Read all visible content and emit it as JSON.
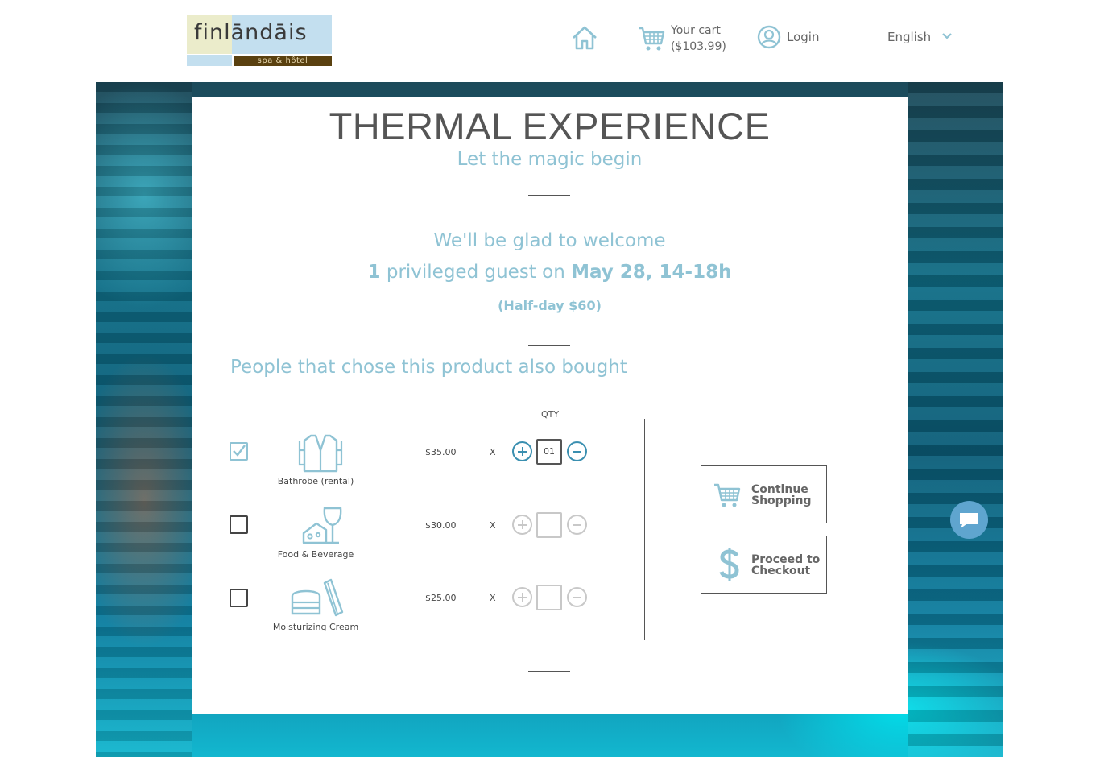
{
  "header": {
    "logo": {
      "word": "finlāndāis",
      "sub": "spa & hôtel"
    },
    "cart": {
      "label": "Your cart",
      "total": "($103.99)"
    },
    "login_label": "Login",
    "language": "English"
  },
  "card": {
    "title": "THERMAL EXPERIENCE",
    "tagline": "Let the magic begin",
    "welcome": "We'll be glad to welcome",
    "guest_count": "1",
    "guest_text": " privileged guest on ",
    "date": "May 28, 14-18h",
    "rate": "(Half-day $60)",
    "also_bought": "People that chose this product also bought",
    "qty_header": "QTY",
    "products": [
      {
        "name": "Bathrobe (rental)",
        "icon": "bathrobe-icon",
        "price": "$35.00",
        "times": "X",
        "qty": "01",
        "checked": true
      },
      {
        "name": "Food & Beverage",
        "icon": "food-beverage-icon",
        "price": "$30.00",
        "times": "X",
        "qty": "",
        "checked": false
      },
      {
        "name": "Moisturizing Cream",
        "icon": "cream-icon",
        "price": "$25.00",
        "times": "X",
        "qty": "",
        "checked": false
      }
    ],
    "buttons": {
      "continue": {
        "line1": "Continue",
        "line2": "Shopping"
      },
      "checkout": {
        "line1": "Proceed to",
        "line2": "Checkout"
      }
    }
  },
  "colors": {
    "accent": "#8fc3d4",
    "stepper": "#3a8fb0",
    "chat": "#5fa5cf"
  }
}
